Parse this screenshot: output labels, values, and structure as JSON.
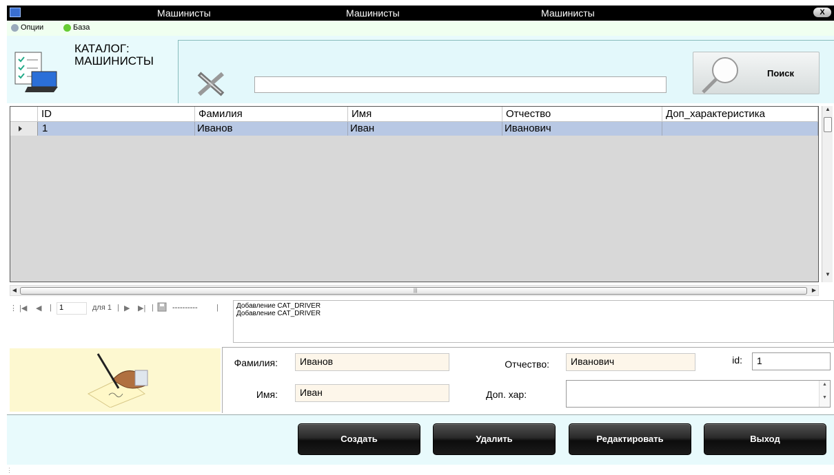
{
  "window": {
    "titles": [
      "Машинисты",
      "Машинисты",
      "Машинисты"
    ],
    "close_label": "X"
  },
  "menu": {
    "items": [
      {
        "label": "Опции",
        "icon": "options-icon"
      },
      {
        "label": "База",
        "icon": "database-icon"
      }
    ]
  },
  "header": {
    "catalog_title": "КАТАЛОГ: МАШИНИСТЫ",
    "search_value": "",
    "search_button_label": "Поиск"
  },
  "grid": {
    "columns": [
      "ID",
      "Фамилия",
      "Имя",
      "Отчество",
      "Доп_характеристика"
    ],
    "rows": [
      {
        "id": "1",
        "last_name": "Иванов",
        "first_name": "Иван",
        "patronymic": "Иванович",
        "extra": ""
      }
    ]
  },
  "navigator": {
    "position": "1",
    "of_label": "для 1",
    "status": "----------"
  },
  "log": {
    "lines": [
      "Добавление CAT_DRIVER",
      "Добавление CAT_DRIVER"
    ]
  },
  "form": {
    "last_name_label": "Фамилия:",
    "last_name_value": "Иванов",
    "first_name_label": "Имя:",
    "first_name_value": "Иван",
    "patronymic_label": "Отчество:",
    "patronymic_value": "Иванович",
    "extra_label": "Доп. хар:",
    "extra_value": "",
    "id_label": "id:",
    "id_value": "1"
  },
  "buttons": {
    "create": "Создать",
    "delete": "Удалить",
    "edit": "Редактировать",
    "exit": "Выход"
  },
  "colors": {
    "titlebar": "#000000",
    "header_bg": "#e8fafc",
    "selected_row": "#b8c8e4",
    "signature_bg": "#fdf8d0",
    "button_dark": "#1a1a1a"
  }
}
